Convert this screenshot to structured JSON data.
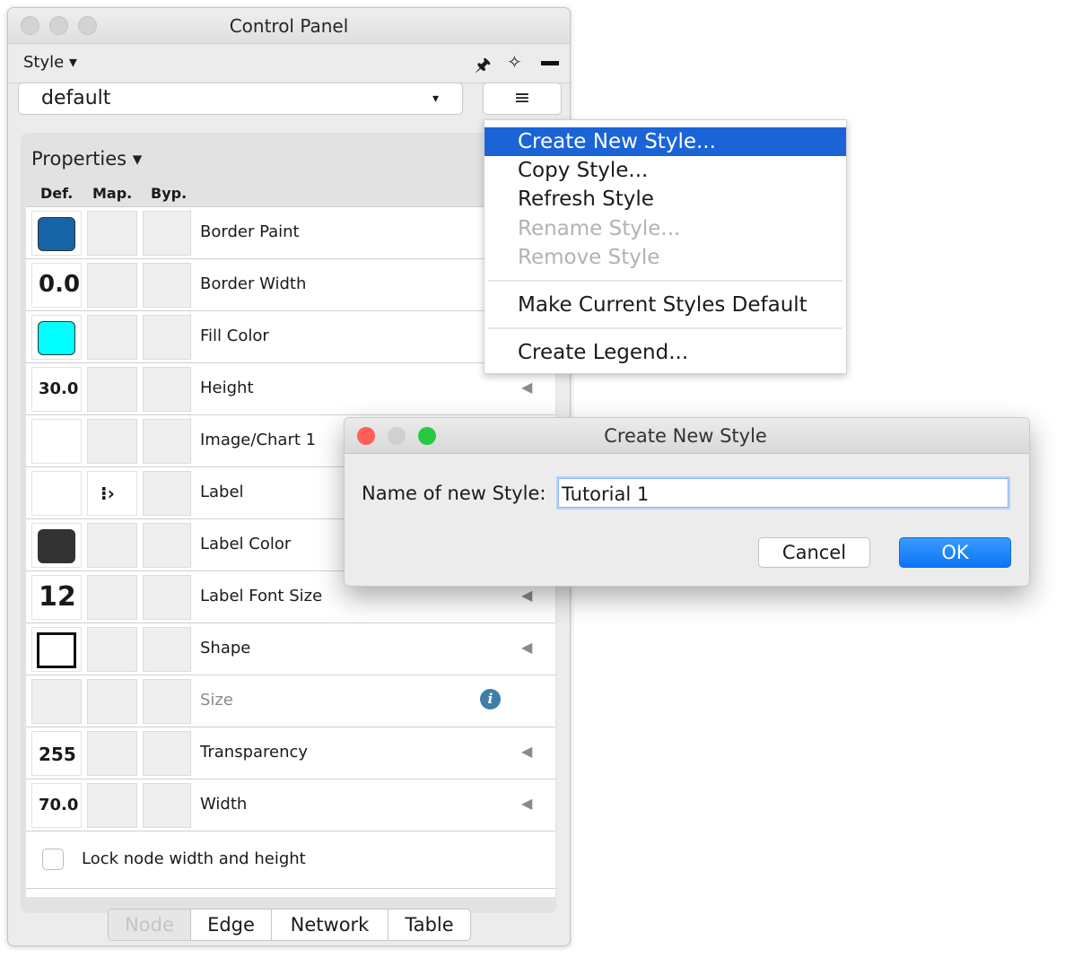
{
  "panel": {
    "title": "Control Panel",
    "style_menu_label": "Style ▾",
    "style_select_value": "default",
    "style_select_arrow": "▾",
    "menu_button_glyph": "≡",
    "pin_glyph": "🖈",
    "unpin_glyph": "✧"
  },
  "properties": {
    "header": "Properties ▾",
    "columns": {
      "def": "Def.",
      "map": "Map.",
      "byp": "Byp."
    },
    "rows": [
      {
        "name": "Border Paint"
      },
      {
        "name": "Border Width",
        "def_value": "0.0"
      },
      {
        "name": "Fill Color"
      },
      {
        "name": "Height",
        "def_value": "30.0",
        "arrow": "◀"
      },
      {
        "name": "Image/Chart 1"
      },
      {
        "name": "Label",
        "map_icon": "⁝›"
      },
      {
        "name": "Label Color"
      },
      {
        "name": "Label Font Size",
        "def_value": "12",
        "arrow": "◀"
      },
      {
        "name": "Shape",
        "arrow": "◀"
      },
      {
        "name": "Size",
        "info_icon": "i"
      },
      {
        "name": "Transparency",
        "def_value": "255",
        "arrow": "◀"
      },
      {
        "name": "Width",
        "def_value": "70.0",
        "arrow": "◀"
      }
    ],
    "colors": {
      "border_paint": "#1565a6",
      "fill_color": "#00ffff",
      "label_color": "#333333"
    },
    "lock_label": "Lock node width and height"
  },
  "tabs": [
    "Node",
    "Edge",
    "Network",
    "Table"
  ],
  "dropdown": {
    "items": [
      {
        "label": "Create New Style...",
        "state": "highlighted"
      },
      {
        "label": "Copy Style...",
        "state": "enabled"
      },
      {
        "label": "Refresh Style",
        "state": "enabled"
      },
      {
        "label": "Rename Style...",
        "state": "disabled"
      },
      {
        "label": "Remove Style",
        "state": "disabled"
      },
      {
        "label": "Make Current Styles Default",
        "state": "enabled"
      },
      {
        "label": "Create Legend...",
        "state": "enabled"
      }
    ]
  },
  "dialog": {
    "title": "Create New Style",
    "label": "Name of new Style:",
    "input_value": "Tutorial 1",
    "cancel_label": "Cancel",
    "ok_label": "OK",
    "traffic_lights": {
      "close": "#ff5f57",
      "minimize": "#d0d0d0",
      "zoom": "#28c840"
    }
  },
  "accent_color": "#1a64d8"
}
